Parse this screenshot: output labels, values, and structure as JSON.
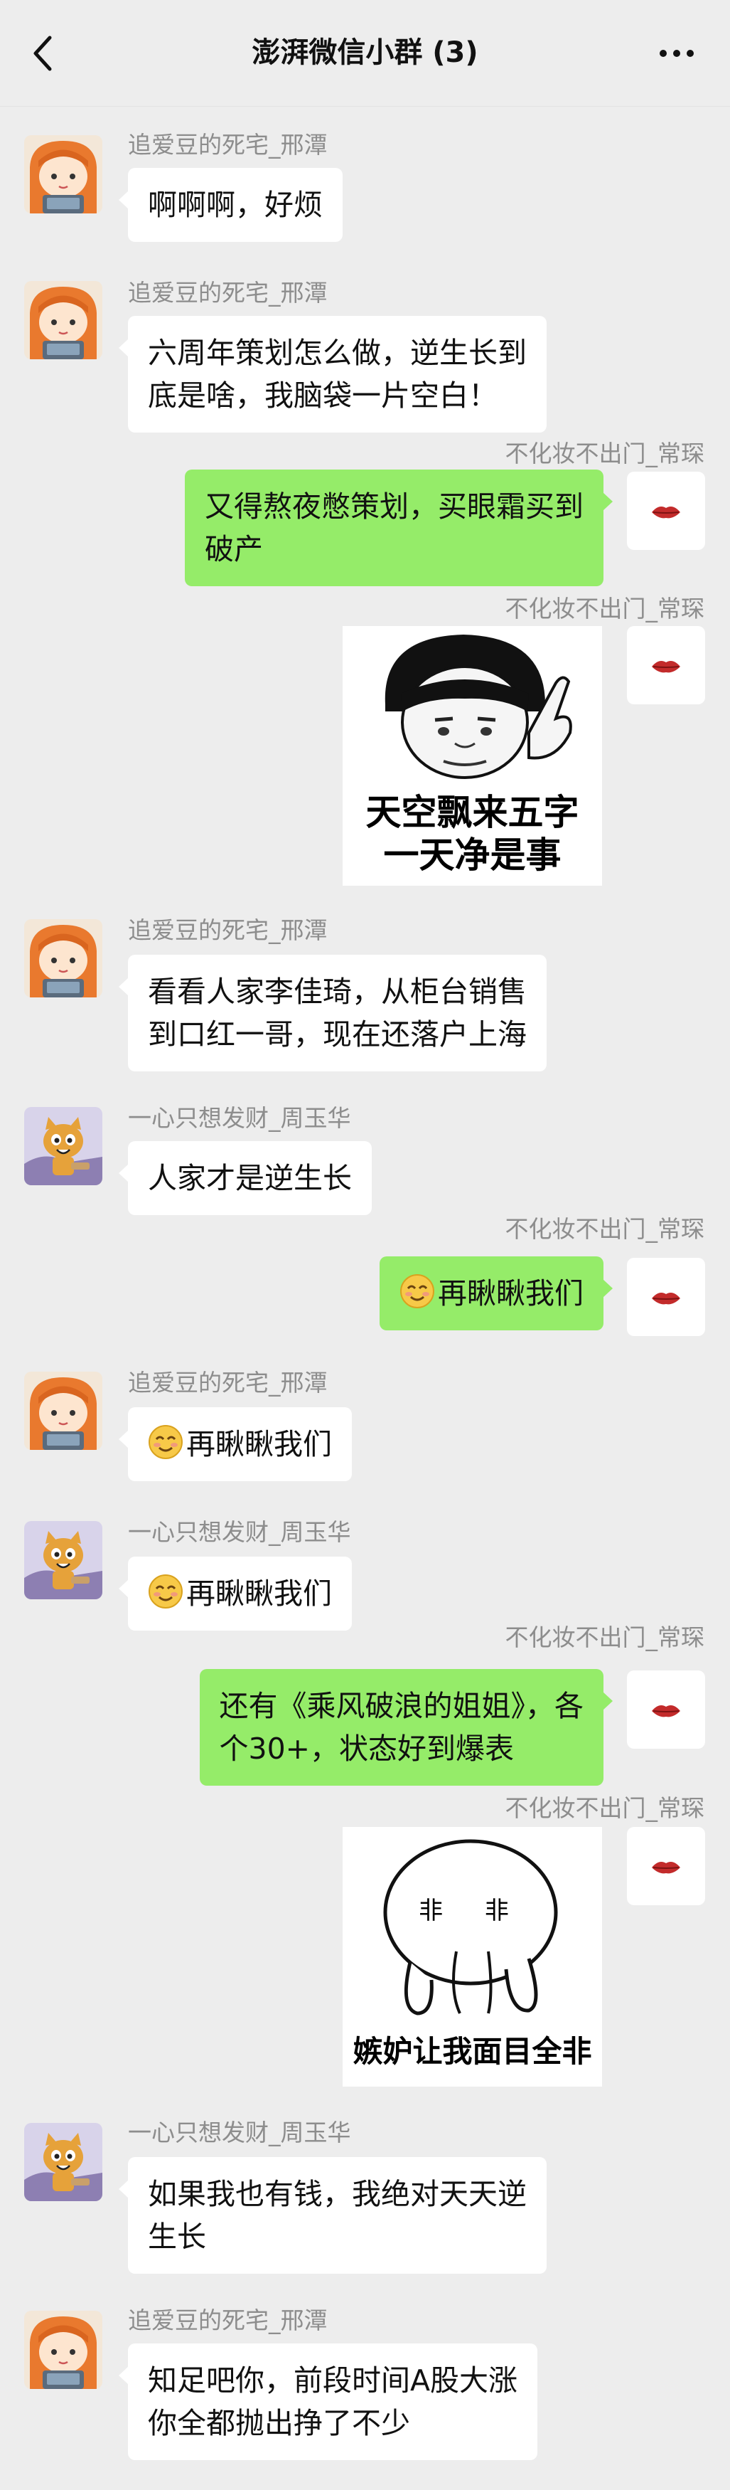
{
  "header": {
    "title": "澎湃微信小群 (3)",
    "back_icon": "chevron-left-icon",
    "more_icon": "more-dots-icon"
  },
  "colors": {
    "background": "#ededed",
    "outgoing_bubble": "#95ec69",
    "incoming_bubble": "#ffffff",
    "name_text": "#8d8d8d"
  },
  "messages": [
    {
      "sender": "追爱豆的死宅_邢潭",
      "lines": [
        "啊啊啊，好烦"
      ]
    },
    {
      "sender": "追爱豆的死宅_邢潭",
      "lines": [
        "六周年策划怎么做，逆生长到",
        "底是啥，我脑袋一片空白！"
      ]
    },
    {
      "sender": "不化妆不出门_常琛",
      "lines": [
        "又得熬夜憋策划，买眼霜买到",
        "破产"
      ]
    },
    {
      "sender": "不化妆不出门_常琛",
      "sticker": {
        "lines": [
          "天空飘来五字",
          "一天净是事"
        ]
      }
    },
    {
      "sender": "追爱豆的死宅_邢潭",
      "lines": [
        "看看人家李佳琦，从柜台销售",
        "到口红一哥，现在还落户上海"
      ]
    },
    {
      "sender": "一心只想发财_周玉华",
      "lines": [
        "人家才是逆生长"
      ]
    },
    {
      "sender": "不化妆不出门_常琛",
      "text": "再瞅瞅我们"
    },
    {
      "sender": "追爱豆的死宅_邢潭",
      "text": "再瞅瞅我们"
    },
    {
      "sender": "一心只想发财_周玉华",
      "text": "再瞅瞅我们"
    },
    {
      "sender": "不化妆不出门_常琛",
      "lines": [
        "还有《乘风破浪的姐姐》，各",
        "个30+，状态好到爆表"
      ]
    },
    {
      "sender": "不化妆不出门_常琛",
      "sticker": {
        "face_text": "非 非",
        "caption": "嫉妒让我面目全非"
      }
    },
    {
      "sender": "一心只想发财_周玉华",
      "lines": [
        "如果我也有钱，我绝对天天逆",
        "生长"
      ]
    },
    {
      "sender": "追爱豆的死宅_邢潭",
      "lines": [
        "知足吧你，前段时间A股大涨",
        "你全都抛出挣了不少"
      ]
    }
  ]
}
